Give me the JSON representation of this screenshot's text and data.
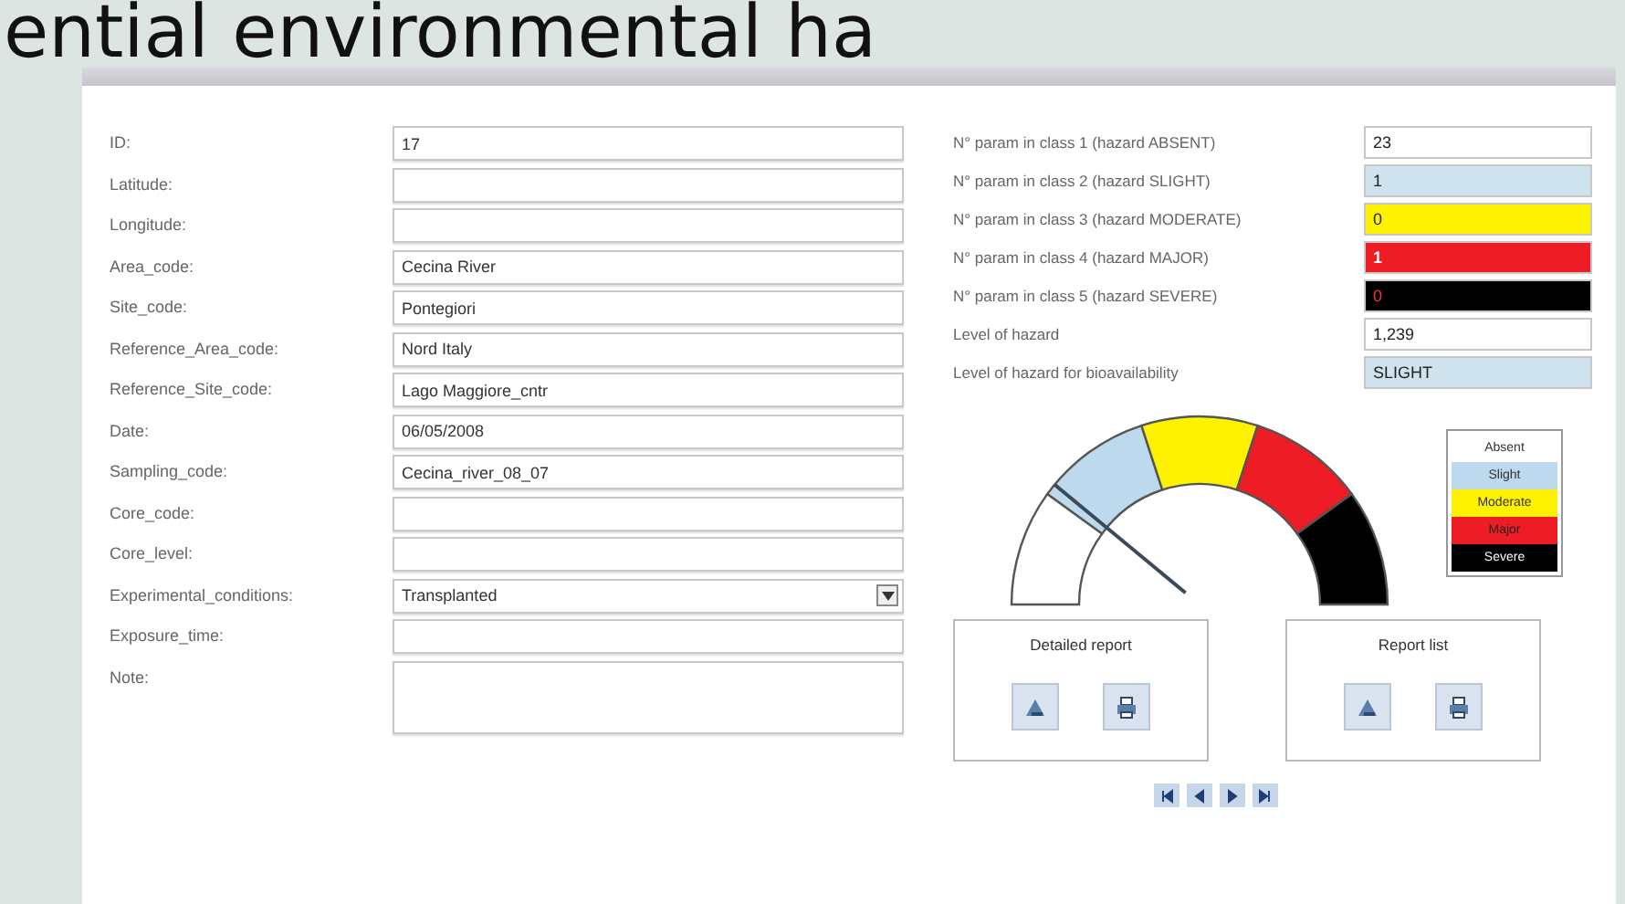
{
  "heading": "ential environmental ha",
  "left_fields": [
    {
      "label": "ID:",
      "value": "17",
      "kind": "text"
    },
    {
      "label": "Latitude:",
      "kind": "text"
    },
    {
      "label": "Longitude:",
      "kind": "text"
    },
    {
      "label": "Area_code:",
      "value": "Cecina River",
      "kind": "text"
    },
    {
      "label": "Site_code:",
      "value": "Pontegiori",
      "kind": "text"
    },
    {
      "label": "Reference_Area_code:",
      "value": "Nord Italy",
      "kind": "text"
    },
    {
      "label": "Reference_Site_code:",
      "value": "Lago Maggiore_cntr",
      "kind": "text"
    },
    {
      "label": "Date:",
      "value": "06/05/2008",
      "kind": "text"
    },
    {
      "label": "Sampling_code:",
      "value": "Cecina_river_08_07",
      "kind": "text"
    },
    {
      "label": "Core_code:",
      "kind": "text"
    },
    {
      "label": "Core_level:",
      "kind": "text"
    },
    {
      "label": "Experimental_conditions:",
      "value": "Transplanted",
      "kind": "dropdown"
    },
    {
      "label": "Exposure_time:",
      "kind": "text"
    },
    {
      "label": "Note:",
      "kind": "memo"
    }
  ],
  "right_fields": [
    {
      "label": "N° param in class 1 (hazard ABSENT)",
      "value": "23",
      "color": "#ffffff"
    },
    {
      "label": "N° param in class 2 (hazard SLIGHT)",
      "value": "1",
      "color": "#cfe3ee"
    },
    {
      "label": "N° param in class 3 (hazard MODERATE)",
      "value": "0",
      "color": "#fff200"
    },
    {
      "label": "N° param in class 4 (hazard MAJOR)",
      "value": "1",
      "color": "#ee1c24"
    },
    {
      "label": "N° param in class 5 (hazard SEVERE)",
      "value": "0",
      "color": "#000000"
    },
    {
      "label": "Level of hazard",
      "value": "1,239",
      "color": "#ffffff"
    },
    {
      "label": "Level of hazard for bioavailability",
      "value": "SLIGHT",
      "color": "#cfe3ee"
    }
  ],
  "legend": [
    {
      "label": "Absent",
      "color": "#ffffff"
    },
    {
      "label": "Slight",
      "color": "#bcd9ee"
    },
    {
      "label": "Moderate",
      "color": "#fff200"
    },
    {
      "label": "Major",
      "color": "#ee1c24"
    },
    {
      "label": "Severe",
      "color": "#000000"
    }
  ],
  "report_groups": [
    {
      "title": "Detailed report"
    },
    {
      "title": "Report list"
    }
  ],
  "nav_buttons": [
    {
      "kind": "first"
    },
    {
      "kind": "previous"
    },
    {
      "kind": "next"
    },
    {
      "kind": "last"
    }
  ]
}
